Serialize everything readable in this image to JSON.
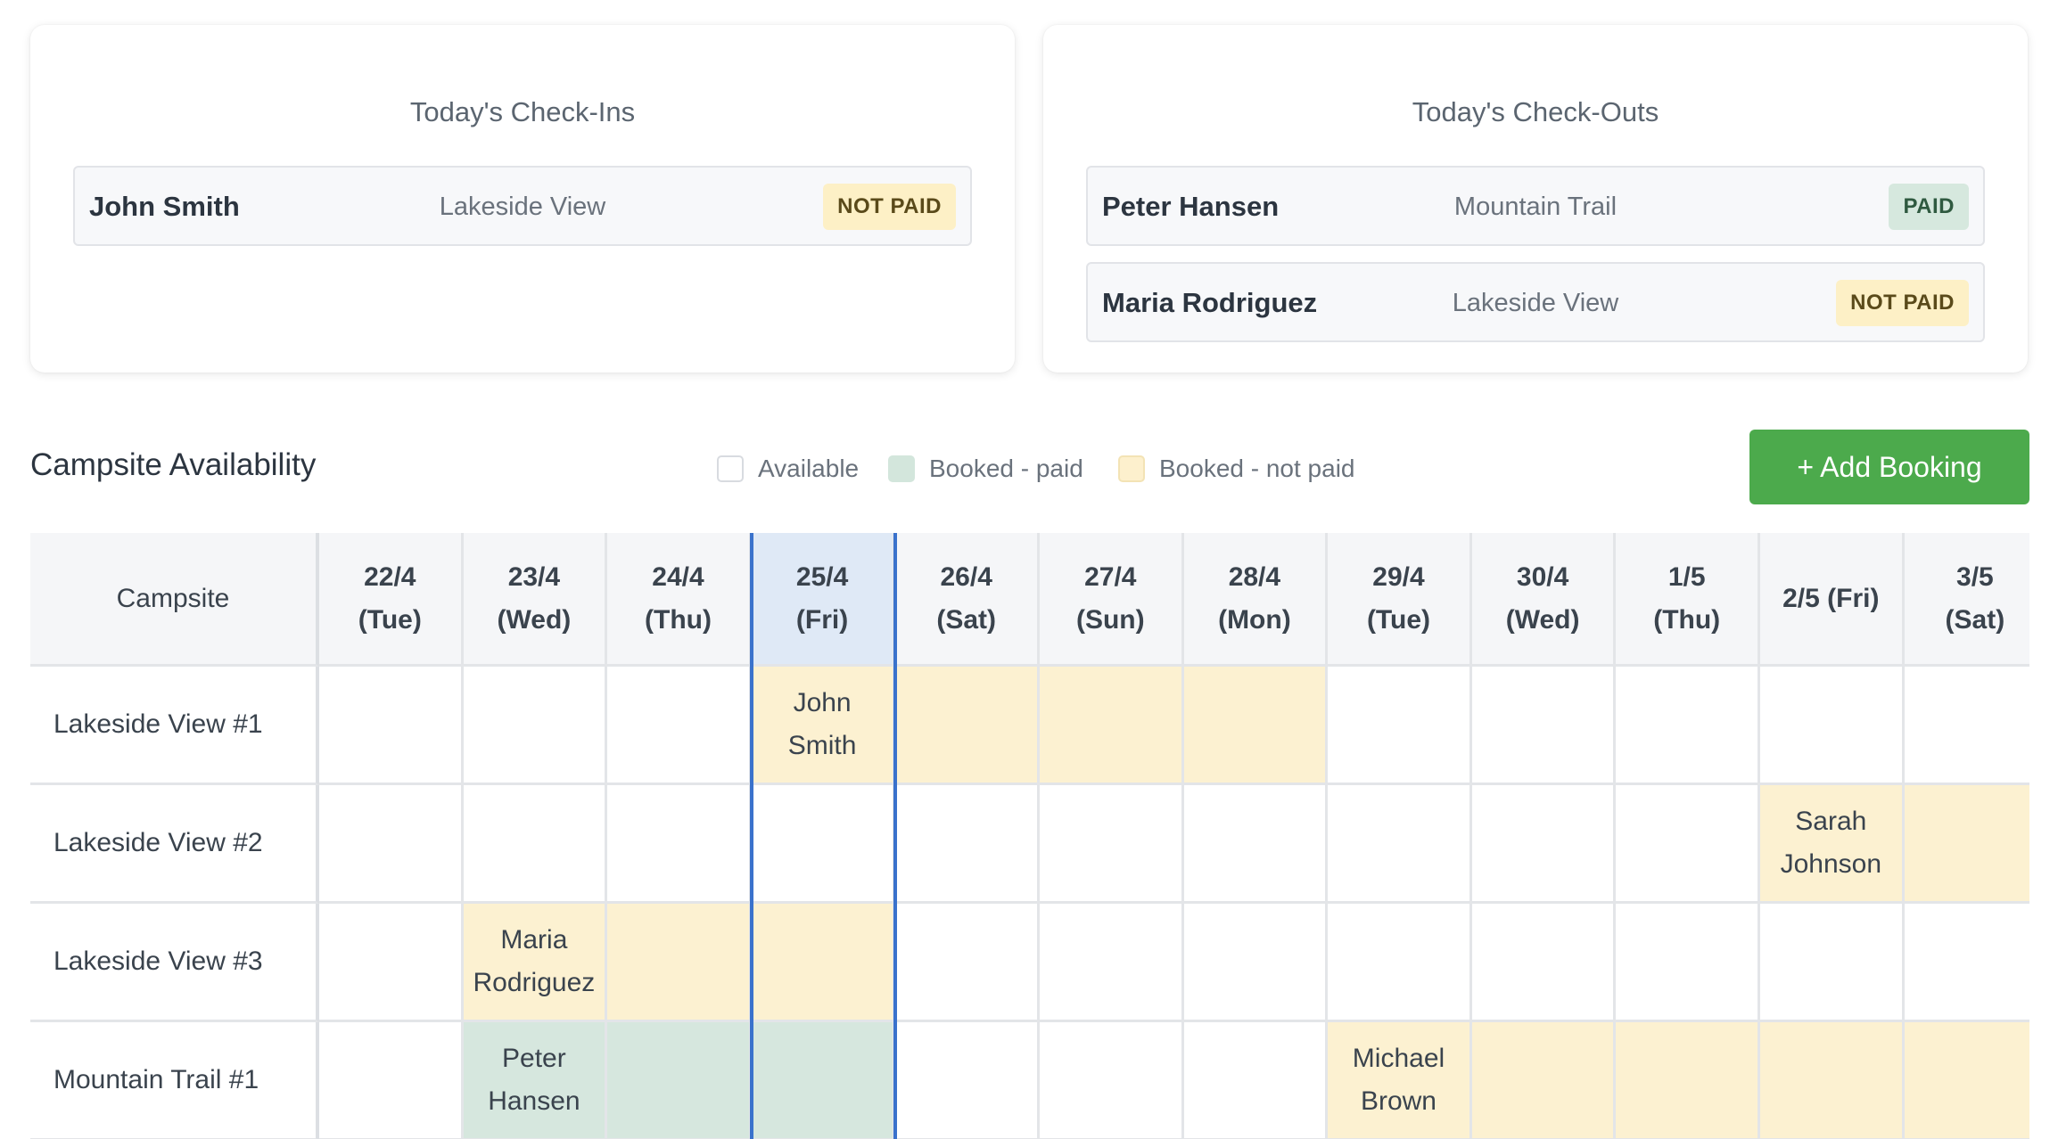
{
  "checkins": {
    "title": "Today's Check-Ins",
    "entries": [
      {
        "name": "John Smith",
        "site": "Lakeside View",
        "status": "NOT PAID",
        "paid": false
      }
    ]
  },
  "checkouts": {
    "title": "Today's Check-Outs",
    "entries": [
      {
        "name": "Peter Hansen",
        "site": "Mountain Trail",
        "status": "PAID",
        "paid": true
      },
      {
        "name": "Maria Rodriguez",
        "site": "Lakeside View",
        "status": "NOT PAID",
        "paid": false
      }
    ]
  },
  "availability": {
    "title": "Campsite Availability",
    "legend": [
      {
        "key": "available",
        "label": "Available"
      },
      {
        "key": "paid",
        "label": "Booked - paid"
      },
      {
        "key": "unpaid",
        "label": "Booked - not paid"
      }
    ],
    "add_button": "+ Add Booking",
    "corner_label": "Campsite",
    "today_index": 3,
    "dates": [
      {
        "date": "22/4",
        "day": "(Tue)"
      },
      {
        "date": "23/4",
        "day": "(Wed)"
      },
      {
        "date": "24/4",
        "day": "(Thu)"
      },
      {
        "date": "25/4",
        "day": "(Fri)"
      },
      {
        "date": "26/4",
        "day": "(Sat)"
      },
      {
        "date": "27/4",
        "day": "(Sun)"
      },
      {
        "date": "28/4",
        "day": "(Mon)"
      },
      {
        "date": "29/4",
        "day": "(Tue)"
      },
      {
        "date": "30/4",
        "day": "(Wed)"
      },
      {
        "date": "1/5",
        "day": "(Thu)"
      },
      {
        "date": "2/5",
        "day": "(Fri)",
        "inline": true
      },
      {
        "date": "3/5",
        "day": "(Sat)"
      }
    ],
    "rows": [
      {
        "site": "Lakeside View #1",
        "cells": [
          "",
          "",
          "",
          "unpaid",
          "unpaid",
          "unpaid",
          "unpaid",
          "",
          "",
          "",
          "",
          ""
        ],
        "labels": {
          "3": [
            "John",
            "Smith"
          ]
        }
      },
      {
        "site": "Lakeside View #2",
        "cells": [
          "",
          "",
          "",
          "",
          "",
          "",
          "",
          "",
          "",
          "",
          "unpaid",
          "unpaid"
        ],
        "labels": {
          "10": [
            "Sarah",
            "Johnson"
          ]
        }
      },
      {
        "site": "Lakeside View #3",
        "cells": [
          "",
          "unpaid",
          "unpaid",
          "unpaid",
          "",
          "",
          "",
          "",
          "",
          "",
          "",
          ""
        ],
        "labels": {
          "1": [
            "Maria",
            "Rodriguez"
          ]
        }
      },
      {
        "site": "Mountain Trail #1",
        "cells": [
          "",
          "paid",
          "paid",
          "paid",
          "",
          "",
          "",
          "unpaid",
          "unpaid",
          "unpaid",
          "unpaid",
          "unpaid"
        ],
        "labels": {
          "1": [
            "Peter",
            "Hansen"
          ],
          "7": [
            "Michael",
            "Brown"
          ]
        }
      }
    ]
  }
}
